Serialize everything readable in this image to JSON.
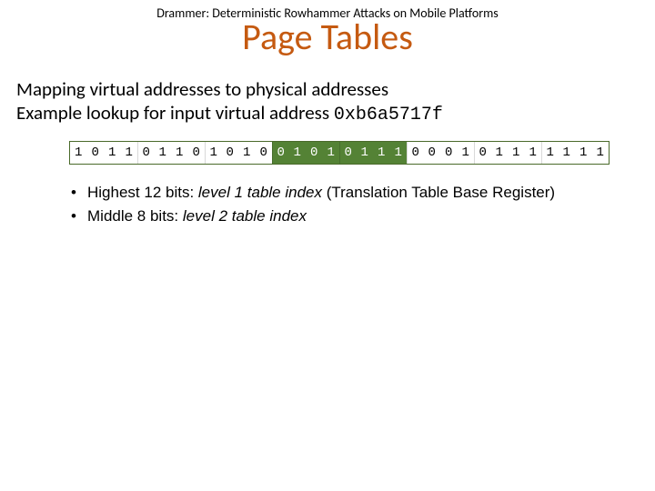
{
  "header": "Drammer: Deterministic Rowhammer Attacks on Mobile Platforms",
  "title": "Page Tables",
  "body": {
    "line1": "Mapping virtual addresses to physical addresses",
    "line2_prefix": "Example lookup for input virtual address ",
    "address": "0xb6a5717f"
  },
  "bits": {
    "values": [
      "1",
      "0",
      "1",
      "1",
      "0",
      "1",
      "1",
      "0",
      "1",
      "0",
      "1",
      "0",
      "0",
      "1",
      "0",
      "1",
      "0",
      "1",
      "1",
      "1",
      "0",
      "0",
      "0",
      "1",
      "0",
      "1",
      "1",
      "1",
      "1",
      "1",
      "1",
      "1"
    ],
    "highlight_start": 12,
    "highlight_end": 19,
    "nibble_separator_every": 4
  },
  "bullets": [
    {
      "prefix": "Highest 12 bits: ",
      "italic": "level 1 table index",
      "suffix": " (Translation Table Base Register)"
    },
    {
      "prefix": "Middle 8 bits: ",
      "italic": "level 2 table index"
    }
  ]
}
